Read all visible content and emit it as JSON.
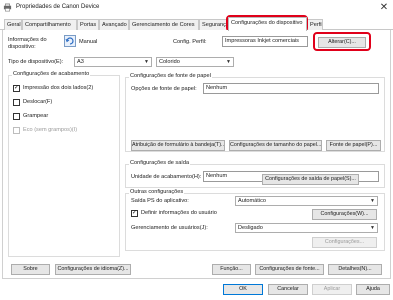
{
  "window": {
    "title": "Propriedades de Canon Device",
    "close_glyph": "✕"
  },
  "tabs": [
    {
      "label": "Geral"
    },
    {
      "label": "Compartilhamento"
    },
    {
      "label": "Portas"
    },
    {
      "label": "Avançado"
    },
    {
      "label": "Gerenciamento de Cores"
    },
    {
      "label": "Segurança"
    },
    {
      "label": "Configurações do dispositivo"
    },
    {
      "label": "Perfil"
    }
  ],
  "device_info": {
    "label": "Informações do dispositivo:",
    "mode": "Manual",
    "config_profile_label": "Config. Perfil:",
    "config_profile_value": "Impressoras Inkjet comerciais",
    "change_button": "Alterar(C)..."
  },
  "device_type": {
    "label": "Tipo de dispositivo(E):",
    "paper_value": "A3",
    "color_value": "Colorido"
  },
  "finishing": {
    "title": "Configurações de acabamento",
    "duplex": {
      "label": "Impressão dos dois lados(2)",
      "checked": true
    },
    "offset": {
      "label": "Deslocar(F)",
      "checked": false
    },
    "staple": {
      "label": "Grampear",
      "checked": false
    },
    "eco": {
      "label": "Eco (sem grampos)(I)",
      "checked": false
    }
  },
  "paper_source": {
    "title": "Configurações de fonte de papel",
    "options_label": "Opções de fonte de papel:",
    "options_value": "Nenhum",
    "btn_tray": "Atribuição de formulário à bandeja(T)...",
    "btn_paper_size": "Configurações de tamanho do papel...",
    "btn_paper_source": "Fonte de papel(P)..."
  },
  "output": {
    "title": "Configurações de saída",
    "finishing_unit_label": "Unidade de acabamento(H):",
    "finishing_unit_value": "Nenhum",
    "btn_output": "Configurações de saída de papel(S)..."
  },
  "other": {
    "title": "Outras configurações",
    "spool_label": "Saída PS do aplicativo:",
    "spool_value": "Automático",
    "define_user_label": "Definir informações do usuário",
    "define_user_checked": true,
    "btn_user_settings": "Configurações(W)...",
    "user_mgmt_label": "Gerenciamento de usuários(J):",
    "user_mgmt_value": "Desligado",
    "btn_settings_disabled": "Configurações..."
  },
  "bottom_row": {
    "about": "Sobre",
    "language": "Configurações de idioma(Z)...",
    "function": "Função...",
    "font": "Configurações de fonte...",
    "details": "Detalhes(N)..."
  },
  "dialog_buttons": {
    "ok": "OK",
    "cancel": "Cancelar",
    "apply": "Aplicar",
    "help": "Ajuda"
  },
  "colors": {
    "highlight": "#e0001a",
    "tab_bg": "#f0f0f0",
    "button_bg": "#e6e6e6"
  }
}
